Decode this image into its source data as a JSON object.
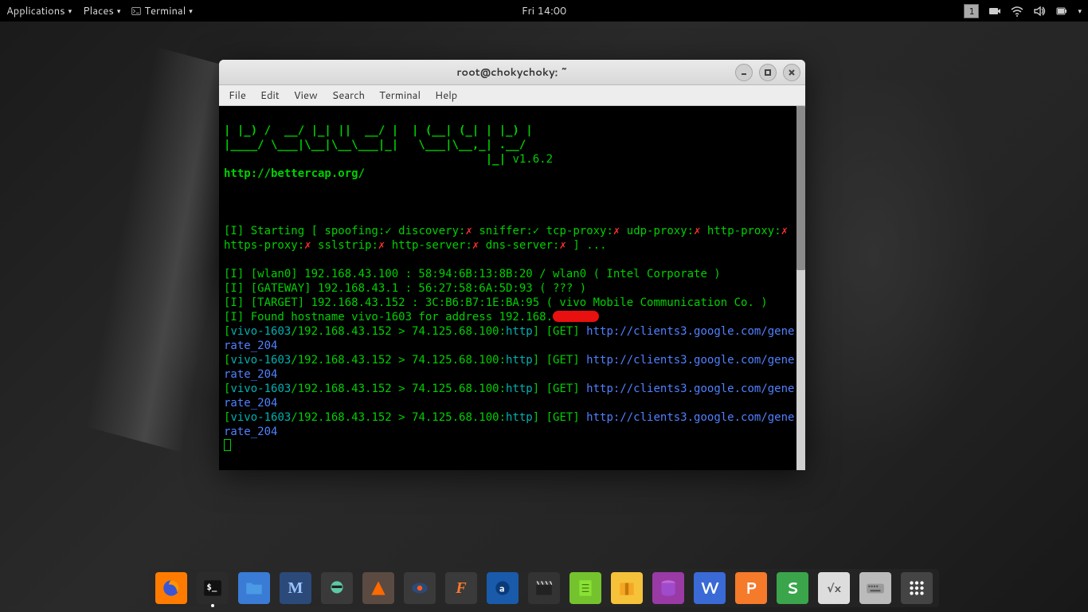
{
  "topbar": {
    "applications": "Applications",
    "places": "Places",
    "terminal": "Terminal",
    "clock": "Fri 14:00",
    "workspace_badge": "1"
  },
  "window": {
    "title": "root@chokychoky: ~"
  },
  "menubar": {
    "file": "File",
    "edit": "Edit",
    "view": "View",
    "search": "Search",
    "terminal": "Terminal",
    "help": "Help"
  },
  "term": {
    "ascii1": "| |_) /  __/ |_| ||  __/ |  | (__| (_| | |_) |",
    "ascii2": "|____/ \\___|\\__|\\__\\___|_|   \\___|\\__,_| .__/ ",
    "ascii3": "                                       |_| ",
    "version": "v1.6.2",
    "url": "http://bettercap.org/",
    "start_prefix": "[I] Starting [ spoofing:",
    "check": "✓",
    "cross": "✗",
    "start_disc": " discovery:",
    "start_sniff": " sniffer:",
    "start_tcp": " tcp-proxy:",
    "start_udp": " udp-proxy:",
    "start_httppx": " http-proxy:",
    "start_httpspx": " https-proxy:",
    "start_sslstrip": " sslstrip:",
    "start_httpsrv": " http-server:",
    "start_dnssrv": " dns-server:",
    "start_tail": " ] ...",
    "line_wlan": "[I] [wlan0] 192.168.43.100 : 58:94:6B:13:8B:20 / wlan0 ( Intel Corporate )",
    "line_gw": "[I] [GATEWAY] 192.168.43.1 : 56:27:58:6A:5D:93 ( ??? )",
    "line_tgt": "[I] [TARGET] 192.168.43.152 : 3C:B6:B7:1E:BA:95 ( vivo Mobile Communication Co. )",
    "line_found_a": "[I] Found hostname vivo-1603 for address 192.168.",
    "req_host": "vivo-1603",
    "req_mid": "/192.168.43.152 > 74.125.68.100:",
    "req_proto": "http",
    "req_close_get": "] [GET] ",
    "req_url": "http://clients3.google.com/generate_204",
    "open_br": "[",
    "close_br": "]"
  },
  "dock": {
    "firefox": "Firefox",
    "terminal": "Terminal",
    "files": "Files",
    "metasploit": "Metasploit",
    "maltego": "Maltego",
    "burp": "Burp Suite",
    "zenmap": "Zenmap",
    "faraday": "Faraday",
    "armitage": "Armitage",
    "video": "Video Tool",
    "notes": "Text Editor",
    "archive": "Archive Manager",
    "db": "Database",
    "wps_w": "WPS Writer",
    "wps_p": "WPS Presentation",
    "wps_s": "WPS Spreadsheets",
    "math": "LibreOffice Math",
    "keyboard": "Keyboard",
    "apps": "Show Applications"
  },
  "colors": {
    "green": "#00d000",
    "cyan": "#00b0b0",
    "blue": "#5080ff",
    "red": "#ff3030",
    "bg_wall1": "#2a2a2a",
    "bg_term": "#000000"
  }
}
